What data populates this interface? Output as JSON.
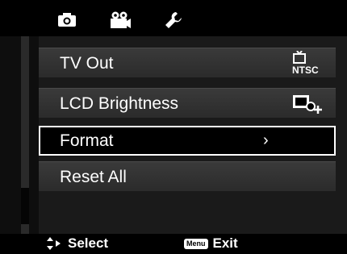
{
  "tabs": [
    {
      "icon": "camera-icon"
    },
    {
      "icon": "video-camera-icon"
    },
    {
      "icon": "wrench-icon"
    }
  ],
  "menu": {
    "items": [
      {
        "label": "TV Out",
        "value_icon": "tv-ntsc-icon",
        "value_text": "NTSC"
      },
      {
        "label": "LCD Brightness",
        "value_icon": "lcd-brightness-icon"
      },
      {
        "label": "Format",
        "chevron": "›"
      },
      {
        "label": "Reset All"
      }
    ]
  },
  "footer": {
    "select_label": "Select",
    "menu_badge": "Menu",
    "exit_label": "Exit"
  }
}
